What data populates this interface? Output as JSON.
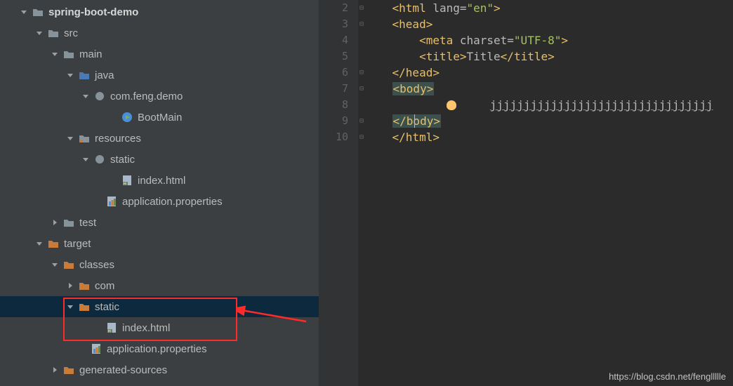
{
  "tree": [
    {
      "indent": 28,
      "chev": "down",
      "icon": "folder-dark",
      "label": "spring-boot-demo",
      "bold": true,
      "selected": false
    },
    {
      "indent": 50,
      "chev": "down",
      "icon": "folder-dark",
      "label": "src",
      "bold": false,
      "selected": false
    },
    {
      "indent": 72,
      "chev": "down",
      "icon": "folder-dark",
      "label": "main",
      "bold": false,
      "selected": false
    },
    {
      "indent": 94,
      "chev": "down",
      "icon": "folder-src",
      "label": "java",
      "bold": false,
      "selected": false
    },
    {
      "indent": 116,
      "chev": "down",
      "icon": "package",
      "label": "com.feng.demo",
      "bold": false,
      "selected": false
    },
    {
      "indent": 155,
      "chev": "none",
      "icon": "class-run",
      "label": "BootMain",
      "bold": false,
      "selected": false
    },
    {
      "indent": 94,
      "chev": "down",
      "icon": "folder-res",
      "label": "resources",
      "bold": false,
      "selected": false
    },
    {
      "indent": 116,
      "chev": "down",
      "icon": "package",
      "label": "static",
      "bold": false,
      "selected": false
    },
    {
      "indent": 155,
      "chev": "none",
      "icon": "html-file",
      "label": "index.html",
      "bold": false,
      "selected": false
    },
    {
      "indent": 133,
      "chev": "none",
      "icon": "props-file",
      "label": "application.properties",
      "bold": false,
      "selected": false
    },
    {
      "indent": 72,
      "chev": "right",
      "icon": "folder-dark",
      "label": "test",
      "bold": false,
      "selected": false
    },
    {
      "indent": 50,
      "chev": "down",
      "icon": "folder-orange",
      "label": "target",
      "bold": false,
      "selected": false
    },
    {
      "indent": 72,
      "chev": "down",
      "icon": "folder-orange",
      "label": "classes",
      "bold": false,
      "selected": false
    },
    {
      "indent": 94,
      "chev": "right",
      "icon": "folder-orange",
      "label": "com",
      "bold": false,
      "selected": false
    },
    {
      "indent": 94,
      "chev": "down",
      "icon": "folder-orange",
      "label": "static",
      "bold": false,
      "selected": true
    },
    {
      "indent": 133,
      "chev": "none",
      "icon": "html-file",
      "label": "index.html",
      "bold": false,
      "selected": false
    },
    {
      "indent": 111,
      "chev": "none",
      "icon": "props-file",
      "label": "application.properties",
      "bold": false,
      "selected": false
    },
    {
      "indent": 72,
      "chev": "right",
      "icon": "folder-orange",
      "label": "generated-sources",
      "bold": false,
      "selected": false
    }
  ],
  "gutter": [
    "2",
    "3",
    "4",
    "5",
    "6",
    "7",
    "8",
    "9",
    "10"
  ],
  "code": {
    "l2": {
      "ind": "    ",
      "tag_o": "<html ",
      "attr": "lang=",
      "val": "\"en\"",
      "tag_c": ">"
    },
    "l3": {
      "ind": "    ",
      "tag": "<head>"
    },
    "l4": {
      "ind": "        ",
      "tag_o": "<meta ",
      "attr": "charset=",
      "val": "\"UTF-8\"",
      "tag_c": ">"
    },
    "l5": {
      "ind": "        ",
      "open": "<title>",
      "text": "Title",
      "close": "</title>"
    },
    "l6": {
      "ind": "    ",
      "tag": "</head>"
    },
    "l7": {
      "ind": "    ",
      "tag": "<body>"
    },
    "l8": {
      "ind": "            ",
      "text": "jjjjjjjjjjjjjjjjjjjjjjjjjjjjjjjjj"
    },
    "l9": {
      "ind": "    ",
      "tag": "</body>"
    },
    "l10": {
      "ind": "    ",
      "tag": "</html>"
    }
  },
  "watermark": "https://blog.csdn.net/fengllllle"
}
